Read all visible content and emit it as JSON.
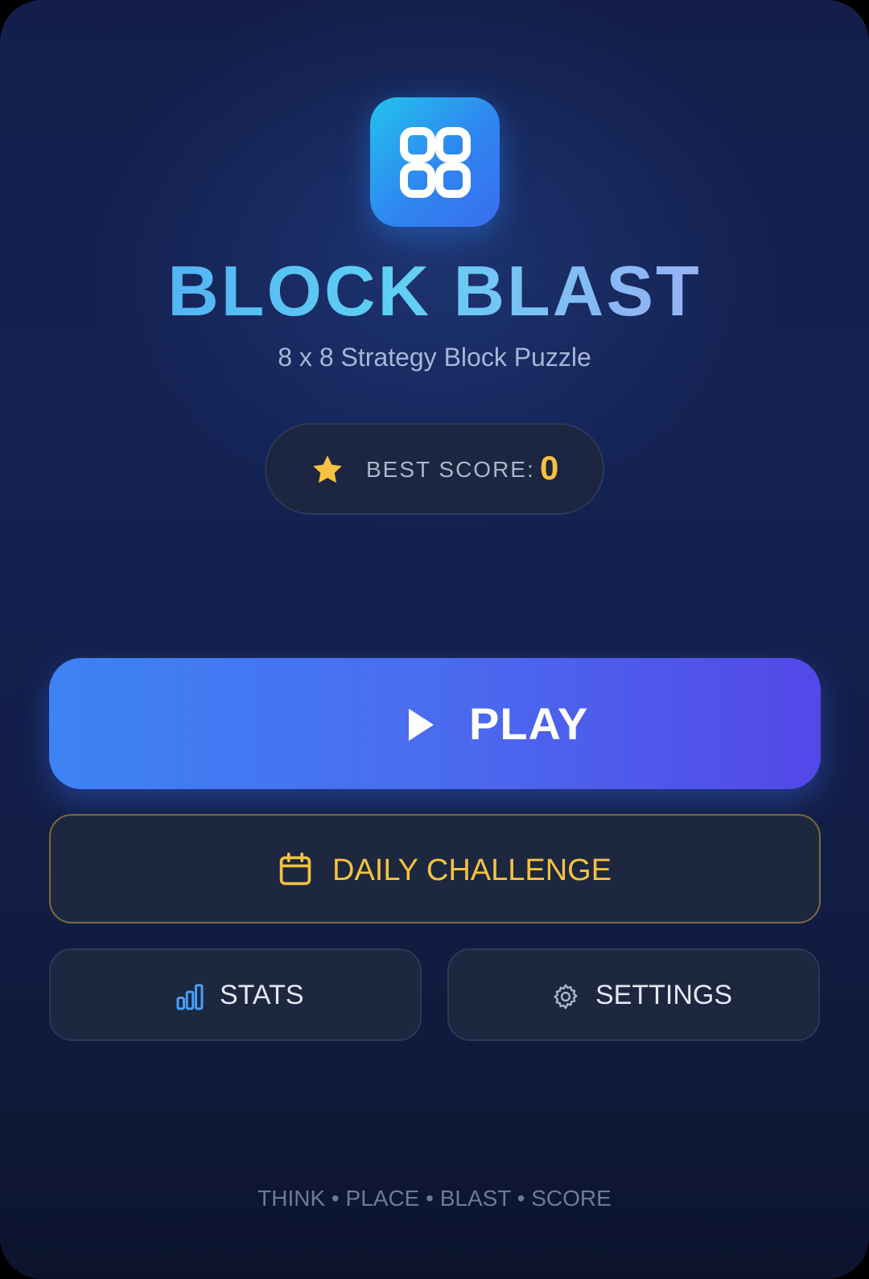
{
  "app": {
    "title": "BLOCK BLAST",
    "subtitle": "8 x 8 Strategy Block Puzzle",
    "icon": "block-grid-icon"
  },
  "best_score": {
    "label": "BEST SCORE:",
    "value": "0",
    "icon": "star-icon"
  },
  "buttons": {
    "play": {
      "label": "PLAY",
      "icon": "play-icon"
    },
    "daily_challenge": {
      "label": "DAILY CHALLENGE",
      "icon": "calendar-icon"
    },
    "stats": {
      "label": "STATS",
      "icon": "bar-chart-icon"
    },
    "settings": {
      "label": "SETTINGS",
      "icon": "gear-icon"
    }
  },
  "tagline": "THINK • PLACE • BLAST • SCORE",
  "colors": {
    "background": "#142253",
    "accent_blue": "#3d83f4",
    "accent_purple": "#5348e8",
    "gold": "#f3c23f",
    "card": "#1d2740"
  }
}
